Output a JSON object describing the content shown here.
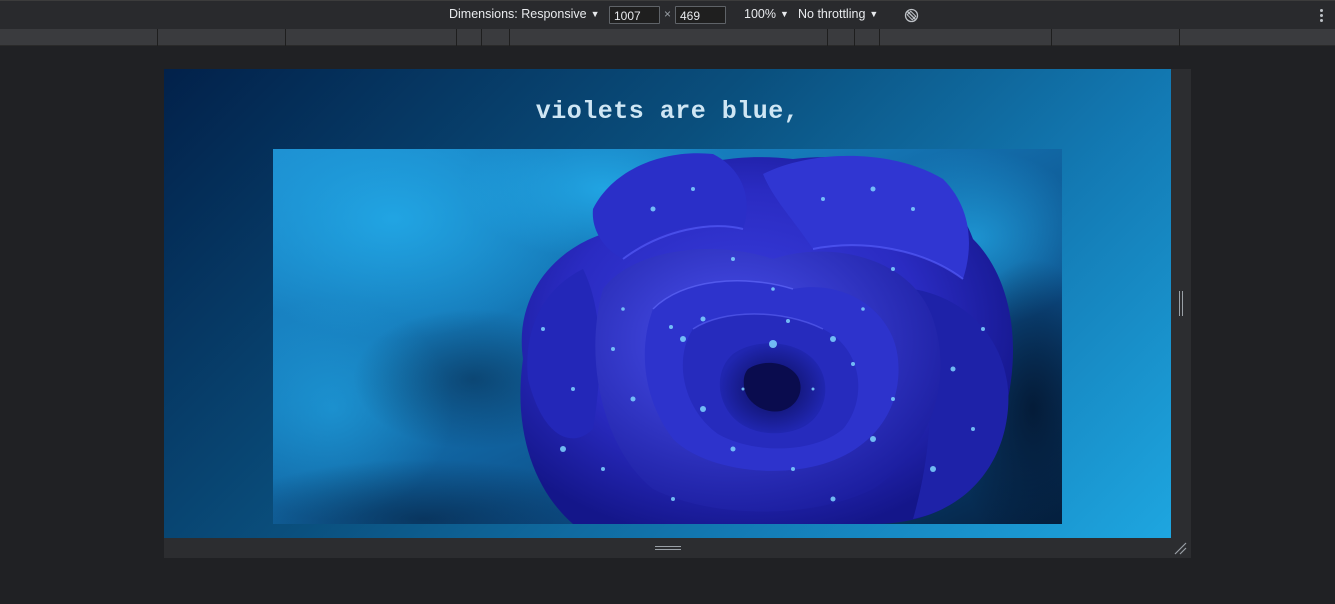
{
  "toolbar": {
    "dimensions_label": "Dimensions: Responsive",
    "width_value": "1007",
    "times": "×",
    "height_value": "469",
    "zoom": "100%",
    "throttling": "No throttling",
    "icons": [
      "rotate-icon",
      "more-options-icon",
      "caret-down-icon"
    ]
  },
  "page": {
    "heading": "violets are blue,",
    "image_alt": "blue rose with water droplets"
  }
}
